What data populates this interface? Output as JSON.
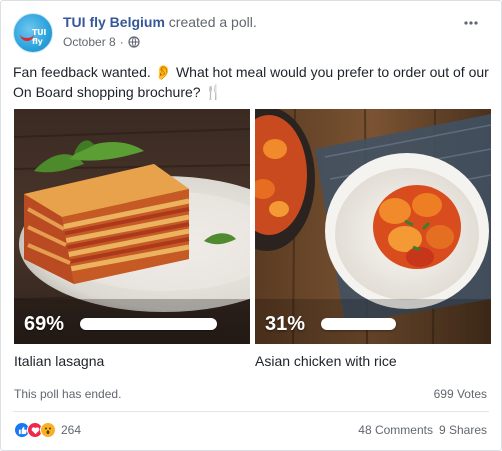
{
  "post": {
    "author": "TUI fly Belgium",
    "action": "created a poll.",
    "date": "October 8",
    "separator": "·",
    "avatar_brand": "TUI fly",
    "text": "Fan feedback wanted. 👂 What hot meal would you prefer to order out of our On Board shopping brochure? 🍴"
  },
  "poll": {
    "options": [
      {
        "label": "Italian lasagna",
        "percent_text": "69%",
        "percent": 69
      },
      {
        "label": "Asian chicken with rice",
        "percent_text": "31%",
        "percent": 31
      }
    ],
    "status": "This poll has ended.",
    "votes": "699 Votes"
  },
  "footer": {
    "reaction_icons": [
      "like-icon",
      "love-icon",
      "wow-icon"
    ],
    "reaction_count": "264",
    "comments": "48 Comments",
    "shares": "9 Shares"
  },
  "colors": {
    "link": "#365899",
    "secondary_text": "#616770",
    "like": "#1877f2",
    "love": "#f0284a",
    "wow": "#f7b125"
  }
}
